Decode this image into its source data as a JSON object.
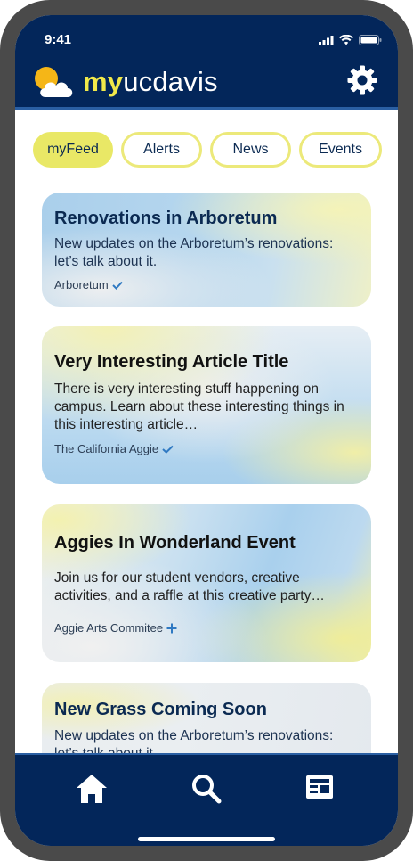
{
  "status": {
    "time": "9:41"
  },
  "header": {
    "brand_my": "my",
    "brand_rest": "ucdavis"
  },
  "filters": [
    {
      "label": "myFeed",
      "active": true
    },
    {
      "label": "Alerts",
      "active": false
    },
    {
      "label": "News",
      "active": false
    },
    {
      "label": "Events",
      "active": false
    }
  ],
  "feed": [
    {
      "title": "Renovations in Arboretum",
      "description": "New updates on the Arboretum’s renovations: let’s talk about it.",
      "source": "Arboretum",
      "source_icon": "check-icon"
    },
    {
      "title": "Very Interesting Article Title",
      "description": "There is very interesting stuff happening on campus. Learn about these interesting things in this interesting article…",
      "source": "The California Aggie",
      "source_icon": "check-icon"
    },
    {
      "title": "Aggies In Wonderland Event",
      "description": "Join us for our student vendors, creative activities, and a raffle at this creative party…",
      "source": "Aggie Arts Commitee",
      "source_icon": "plus-icon"
    },
    {
      "title": "New Grass Coming Soon",
      "description": "New updates on the Arboretum’s renovations: let’s talk about it.",
      "source": "",
      "source_icon": ""
    }
  ],
  "tabbar": [
    "home-icon",
    "search-icon",
    "news-icon"
  ],
  "colors": {
    "navy": "#03265a",
    "accent_yellow": "#f1e94a",
    "chip_border": "#ece97a",
    "check_blue": "#2f79c2"
  }
}
